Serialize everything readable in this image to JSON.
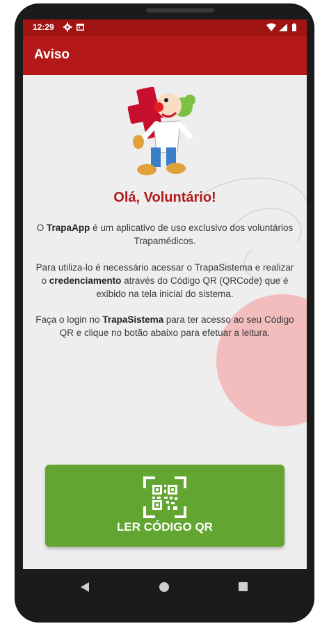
{
  "status_bar": {
    "time": "12:29",
    "left_icons": [
      "gear-icon",
      "calendar-icon"
    ],
    "right_icons": [
      "wifi-icon",
      "signal-icon",
      "battery-icon"
    ]
  },
  "app_bar": {
    "title": "Aviso"
  },
  "content": {
    "headline": "Olá, Voluntário!",
    "p1": {
      "a": "O ",
      "b": "TrapaApp",
      "c": " é um aplicativo de uso exclusivo dos voluntários Trapamédicos."
    },
    "p2": {
      "a": "Para utiliza-lo é necessário acessar o TrapaSistema e realizar o ",
      "b": "credenciamento",
      "c": " através do Código QR (QRCode) que é exibido na tela inicial do sistema."
    },
    "p3": {
      "a": "Faça o login no ",
      "b": "TrapaSistema",
      "c": " para ter acesso ao seu Código QR e clique no botão abaixo para efetuar a leitura."
    }
  },
  "action": {
    "label": "LER CÓDIGO QR",
    "icon": "qr-code-scan-icon"
  },
  "colors": {
    "primary": "#b41818",
    "status": "#a01414",
    "accent": "#63a531",
    "background": "#eeeeee"
  },
  "nav": [
    "back-icon",
    "home-icon",
    "recents-icon"
  ]
}
